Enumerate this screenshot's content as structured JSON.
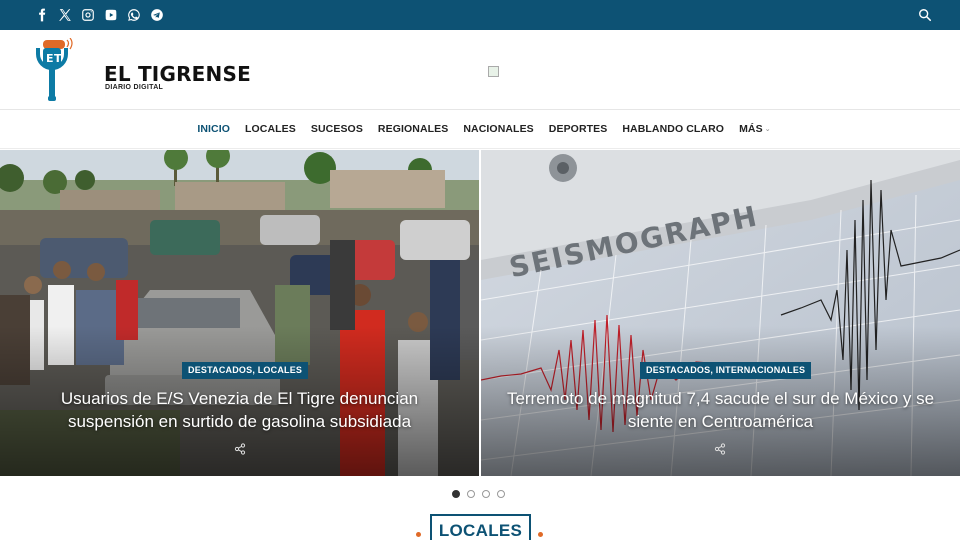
{
  "topbar": {
    "social_icons": [
      "facebook-icon",
      "x-twitter-icon",
      "instagram-icon",
      "youtube-icon",
      "whatsapp-icon",
      "telegram-icon"
    ],
    "search_icon": "search-icon",
    "bg_color": "#0d5274"
  },
  "header": {
    "logo_title": "EL TIGRENSE",
    "logo_subtitle": "DIARIO DIGITAL",
    "logo_icon": "microphone-icon"
  },
  "nav": {
    "items": [
      "INICIO",
      "LOCALES",
      "SUCESOS",
      "REGIONALES",
      "NACIONALES",
      "DEPORTES",
      "HABLANDO CLARO",
      "MÁS"
    ],
    "active": "INICIO",
    "accent_color": "#0d5274"
  },
  "slides": [
    {
      "category": "DESTACADOS, LOCALES",
      "headline": "Usuarios de E/S Venezia de El Tigre denuncian suspensión en surtido de gasolina subsidiada",
      "share_icon": "share-icon"
    },
    {
      "category": "DESTACADOS, INTERNACIONALES",
      "headline": "Terremoto de magnitud 7,4 sacude el sur de México y se siente en Centroamérica",
      "share_icon": "share-icon"
    }
  ],
  "slider_dots": {
    "count": 4,
    "active_index": 0
  },
  "section": {
    "title": "LOCALES",
    "dot_color": "#e06a27"
  }
}
